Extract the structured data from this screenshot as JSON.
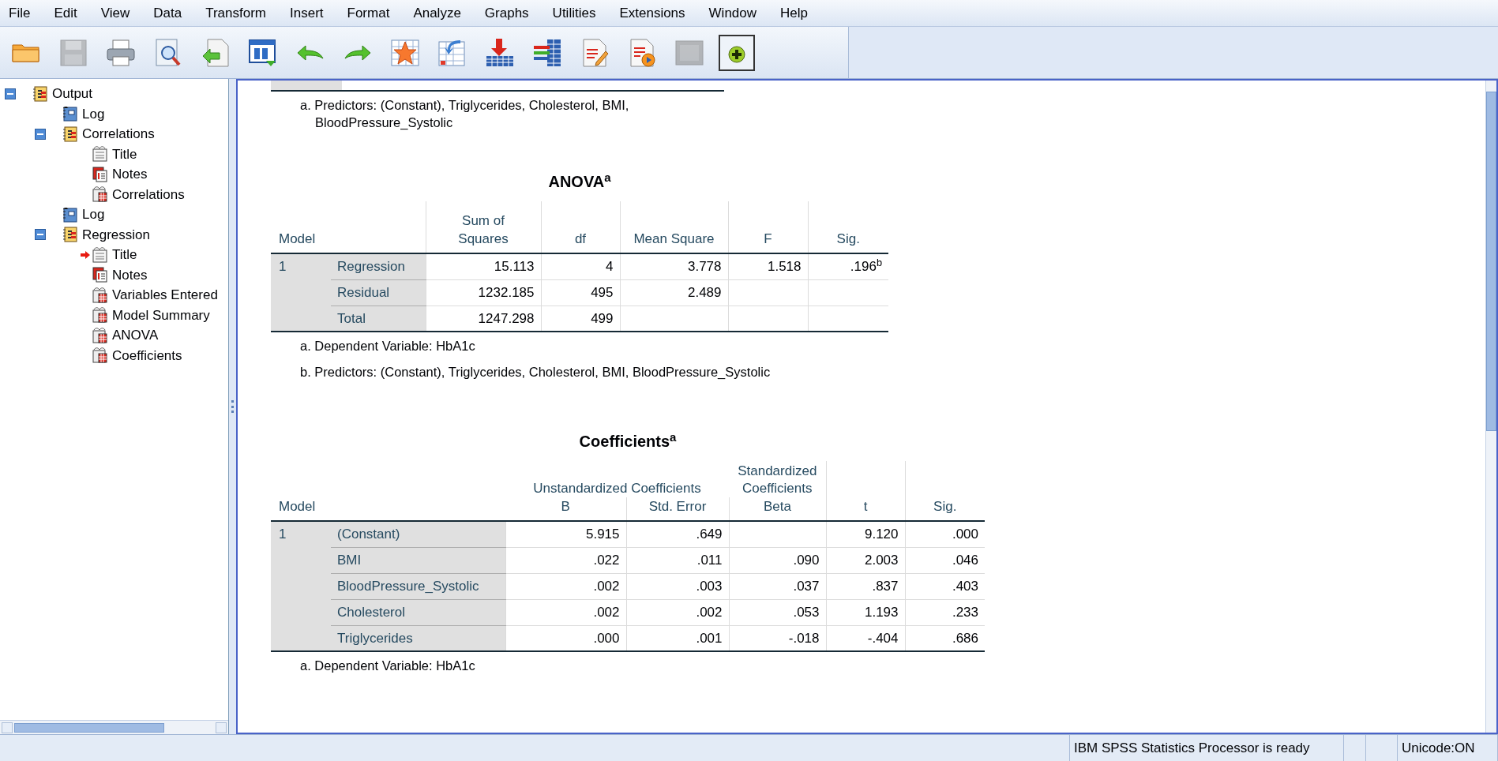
{
  "menu": [
    "File",
    "Edit",
    "View",
    "Data",
    "Transform",
    "Insert",
    "Format",
    "Analyze",
    "Graphs",
    "Utilities",
    "Extensions",
    "Window",
    "Help"
  ],
  "toolbar": [
    {
      "kind": "open",
      "disabled": false
    },
    {
      "kind": "save",
      "disabled": true
    },
    {
      "kind": "print",
      "disabled": false
    },
    {
      "kind": "preview",
      "disabled": false
    },
    {
      "kind": "export",
      "disabled": false
    },
    {
      "kind": "recall",
      "disabled": false
    },
    {
      "kind": "undo",
      "disabled": false
    },
    {
      "kind": "redo",
      "disabled": false
    },
    {
      "kind": "star",
      "disabled": false
    },
    {
      "kind": "goto",
      "disabled": false
    },
    {
      "kind": "insert",
      "disabled": false
    },
    {
      "kind": "variables",
      "disabled": false
    },
    {
      "kind": "edit",
      "disabled": false
    },
    {
      "kind": "play",
      "disabled": false
    },
    {
      "kind": "blank",
      "disabled": true
    },
    {
      "kind": "plus",
      "disabled": false
    }
  ],
  "outline": [
    {
      "label": "Output",
      "kind": "folder",
      "expanded": true,
      "current": false,
      "children": [
        {
          "label": "Log",
          "kind": "log",
          "current": false
        },
        {
          "label": "Correlations",
          "kind": "folder",
          "expanded": true,
          "current": false,
          "children": [
            {
              "label": "Title",
              "kind": "title",
              "current": false
            },
            {
              "label": "Notes",
              "kind": "notes",
              "current": false
            },
            {
              "label": "Correlations",
              "kind": "table",
              "current": false
            }
          ]
        },
        {
          "label": "Log",
          "kind": "log",
          "current": false
        },
        {
          "label": "Regression",
          "kind": "folder",
          "expanded": true,
          "current": false,
          "children": [
            {
              "label": "Title",
              "kind": "title",
              "current": true
            },
            {
              "label": "Notes",
              "kind": "notes",
              "current": false
            },
            {
              "label": "Variables Entered",
              "kind": "table",
              "current": false
            },
            {
              "label": "Model Summary",
              "kind": "table",
              "current": false
            },
            {
              "label": "ANOVA",
              "kind": "table",
              "current": false
            },
            {
              "label": "Coefficients",
              "kind": "table",
              "current": false
            }
          ]
        }
      ]
    }
  ],
  "previous_table_note": "a. Predictors: (Constant), Triglycerides, Cholesterol, BMI, BloodPressure_Systolic",
  "anova": {
    "title": "ANOVA$^{a}$",
    "columns": [
      "Model",
      "",
      "Sum of Squares",
      "df",
      "Mean Square",
      "F",
      "Sig."
    ],
    "rows": [
      [
        "1",
        "Regression",
        "15.113",
        "4",
        "3.778",
        "1.518",
        ".196$^{b}$"
      ],
      [
        "",
        "Residual",
        "1232.185",
        "495",
        "2.489",
        "",
        ""
      ],
      [
        "",
        "Total",
        "1247.298",
        "499",
        "",
        "",
        ""
      ]
    ],
    "notes": [
      "a. Dependent Variable: HbA1c",
      "b. Predictors: (Constant), Triglycerides, Cholesterol, BMI, BloodPressure_Systolic"
    ]
  },
  "coefficients": {
    "title": "Coefficients$^{a}$",
    "header_groups": [
      "Unstandardized Coefficients",
      "Standardized Coefficients"
    ],
    "columns": [
      "Model",
      "",
      "B",
      "Std. Error",
      "Beta",
      "t",
      "Sig."
    ],
    "rows": [
      [
        "1",
        "(Constant)",
        "5.915",
        ".649",
        "",
        "9.120",
        ".000"
      ],
      [
        "",
        "BMI",
        ".022",
        ".011",
        ".090",
        "2.003",
        ".046"
      ],
      [
        "",
        "BloodPressure_Systolic",
        ".002",
        ".003",
        ".037",
        ".837",
        ".403"
      ],
      [
        "",
        "Cholesterol",
        ".002",
        ".002",
        ".053",
        "1.193",
        ".233"
      ],
      [
        "",
        "Triglycerides",
        ".000",
        ".001",
        "-.018",
        "-.404",
        ".686"
      ]
    ],
    "notes": [
      "a. Dependent Variable: HbA1c"
    ]
  },
  "status_bar": {
    "message": "IBM SPSS Statistics Processor is ready",
    "encoding": "Unicode:ON"
  }
}
